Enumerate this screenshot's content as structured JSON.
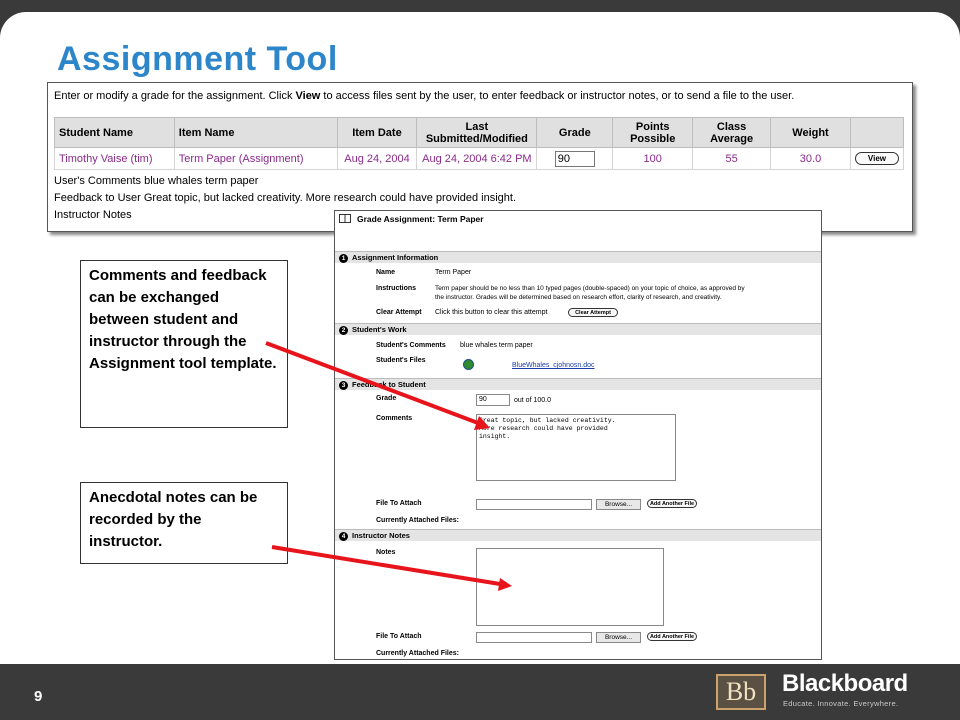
{
  "slide": {
    "title": "Assignment Tool",
    "page_number": "9"
  },
  "brand": {
    "logo_text": "Bb",
    "name": "Blackboard",
    "tagline": "Educate. Innovate. Everywhere."
  },
  "grade_center": {
    "instructions_pre": "Enter or modify a grade for the assignment. Click ",
    "instructions_bold": "View",
    "instructions_post": " to access files sent by the user, to enter feedback or instructor notes, or to send a file to the user.",
    "columns": [
      "Student Name",
      "Item Name",
      "Item Date",
      "Last Submitted/Modified",
      "Grade",
      "Points Possible",
      "Class Average",
      "Weight",
      ""
    ],
    "col_last_line1": "Last",
    "col_last_line2": "Submitted/Modified",
    "row": {
      "student": "Timothy Vaise (tim)",
      "item": "Term Paper (Assignment)",
      "item_date": "Aug 24, 2004",
      "last_modified": "Aug 24, 2004 6:42 PM",
      "grade": "90",
      "points_possible": "100",
      "class_average": "55",
      "weight": "30.0",
      "view_label": "View"
    },
    "comments_line": "User's Comments blue whales term paper",
    "feedback_line": "Feedback to User Great topic, but lacked creativity. More research could have provided insight.",
    "notes_line": "Instructor Notes"
  },
  "grade_assignment": {
    "header": "Grade Assignment: Term Paper",
    "sections": {
      "s1": {
        "num": "1",
        "title": "Assignment Information"
      },
      "s2": {
        "num": "2",
        "title": "Student's Work"
      },
      "s3": {
        "num": "3",
        "title": "Feedback to Student"
      },
      "s4": {
        "num": "4",
        "title": "Instructor Notes"
      }
    },
    "name_label": "Name",
    "name_value": "Term Paper",
    "instructions_label": "Instructions",
    "instructions_value_1": "Term paper should be no less than 10 typed pages (double-spaced) on your topic of choice, as approved by",
    "instructions_value_2": "the instructor.  Grades will be determined based on research effort, clarity of research, and creativity.",
    "clear_label": "Clear Attempt",
    "clear_text": "Click this button to clear this attempt",
    "clear_button": "Clear Attempt",
    "student_comments_label": "Student's Comments",
    "student_comments_value": "blue whales term paper",
    "student_files_label": "Student's Files",
    "student_file_link": "BlueWhales_cjohnosn.doc",
    "grade_label": "Grade",
    "grade_value": "90",
    "grade_suffix": "out of 100.0",
    "comments_label": "Comments",
    "comments_value": "Great topic, but lacked creativity.\nMore research could have provided\ninsight.",
    "file_attach_label": "File To Attach",
    "browse_label": "Browse...",
    "add_file_label": "Add Another File",
    "attached_label": "Currently Attached Files:",
    "notes_label": "Notes"
  },
  "callouts": {
    "c1": "Comments and feedback can be exchanged between student and instructor through the Assignment tool template.",
    "c2": "Anecdotal notes can be recorded by the instructor."
  },
  "colors": {
    "title": "#2c86c9",
    "link_purple": "#8b2a8b",
    "arrow_red": "#e8141c",
    "frame": "#3a3a3a"
  }
}
